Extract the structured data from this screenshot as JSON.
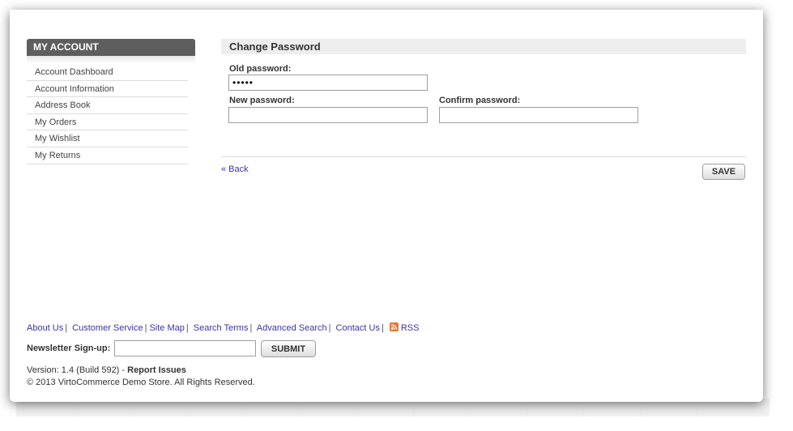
{
  "sidebar": {
    "title": "MY ACCOUNT",
    "items": [
      {
        "label": "Account Dashboard"
      },
      {
        "label": "Account Information"
      },
      {
        "label": "Address Book"
      },
      {
        "label": "My Orders"
      },
      {
        "label": "My Wishlist"
      },
      {
        "label": "My Returns"
      }
    ]
  },
  "form": {
    "title": "Change Password",
    "old_password_label": "Old password:",
    "old_password_value": "•••••",
    "new_password_label": "New password:",
    "new_password_value": "",
    "confirm_password_label": "Confirm password:",
    "confirm_password_value": "",
    "back_label": "« Back",
    "save_label": "SAVE"
  },
  "footer": {
    "links": [
      "About Us",
      "Customer Service",
      "Site Map",
      "Search Terms",
      "Advanced Search",
      "Contact Us",
      "RSS"
    ],
    "separator": "|",
    "newsletter_label": "Newsletter Sign-up:",
    "newsletter_value": "",
    "submit_label": "SUBMIT",
    "version_text": "Version: 1.4 (Build 592) - ",
    "report_issues_label": "Report Issues",
    "copyright": "© 2013 VirtoCommerce Demo Store. All Rights Reserved."
  },
  "colors": {
    "sidebar_header": "#5e5e5e",
    "link": "#3a34a8",
    "rss": "#e8762d"
  },
  "icons": {
    "rss": "rss-icon"
  }
}
